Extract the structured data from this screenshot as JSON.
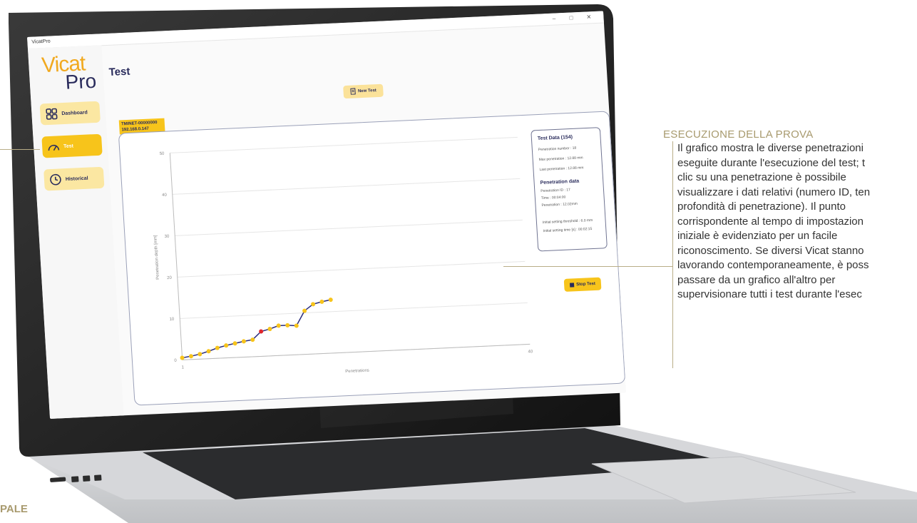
{
  "window": {
    "title": "VicatPro",
    "controls": [
      "–",
      "□",
      "✕"
    ]
  },
  "logo": {
    "line1": "Vicat",
    "line2": "Pro"
  },
  "sidebar": {
    "items": [
      {
        "label": "Dashboard",
        "icon": "dashboard-grid-icon",
        "active": false
      },
      {
        "label": "Test",
        "icon": "gauge-icon",
        "active": true
      },
      {
        "label": "Historical",
        "icon": "history-clock-icon",
        "active": false
      }
    ]
  },
  "page": {
    "title": "Test"
  },
  "toolbar": {
    "new_test_label": "New Test",
    "stop_test_label": "Stop Test"
  },
  "device": {
    "id": "TMINET-00000000",
    "ip": "192.168.0.147"
  },
  "test_data": {
    "title": "Test Data (154)",
    "penetration_number": "Penetration number : 18",
    "max_penetration": "Max penetration : 12.88 mm",
    "last_penetration": "Last penetration : 12.88 mm",
    "pen_title": "Penetration data",
    "pen_id": "Penetration ID : 17",
    "pen_time": "Time : 00:04:00",
    "pen_value": "Penetration : 12.02mm",
    "threshold": "Initial setting threshold : 6.0 mm",
    "setting_time": "Initial setting time [s] : 00:02:15"
  },
  "chart_data": {
    "type": "line",
    "xlabel": "Penetrations",
    "ylabel": "Penetration depth [mm]",
    "xlim": [
      1,
      40
    ],
    "ylim": [
      0,
      50
    ],
    "yticks": [
      "0",
      "10",
      "20",
      "30",
      "40",
      "50"
    ],
    "xticks": [
      "1",
      "40"
    ],
    "series": [
      {
        "color": "#2a2c7c",
        "marker_color": "#f7c41b",
        "highlight_color": "#e0262c",
        "x": [
          1,
          2,
          3,
          4,
          5,
          6,
          7,
          8,
          9,
          10,
          11,
          12,
          13,
          14,
          15,
          16,
          17,
          18
        ],
        "y": [
          0.5,
          0.8,
          1.2,
          1.8,
          2.5,
          3.0,
          3.4,
          3.8,
          4.1,
          6.0,
          6.5,
          7.2,
          7.2,
          7.0,
          10.5,
          12.0,
          12.5,
          12.88
        ],
        "highlighted_index": 9
      }
    ]
  },
  "annotation": {
    "title": "ESECUZIONE DELLA PROVA",
    "lines": [
      "Il grafico mostra le diverse penetrazioni",
      "eseguite durante l'esecuzione del test; t",
      "clic su una penetrazione è possibile",
      "visualizzare i dati relativi (numero ID, ten",
      "profondità di penetrazione). Il punto",
      "corrispondente al tempo di impostazion",
      "iniziale è evidenziato per un facile",
      "riconoscimento. Se diversi Vicat stanno",
      "lavorando contemporaneamente, è poss",
      "passare da un grafico all'altro per",
      "supervisionare tutti i test durante l'esec"
    ]
  },
  "footer": {
    "label": "PALE"
  }
}
